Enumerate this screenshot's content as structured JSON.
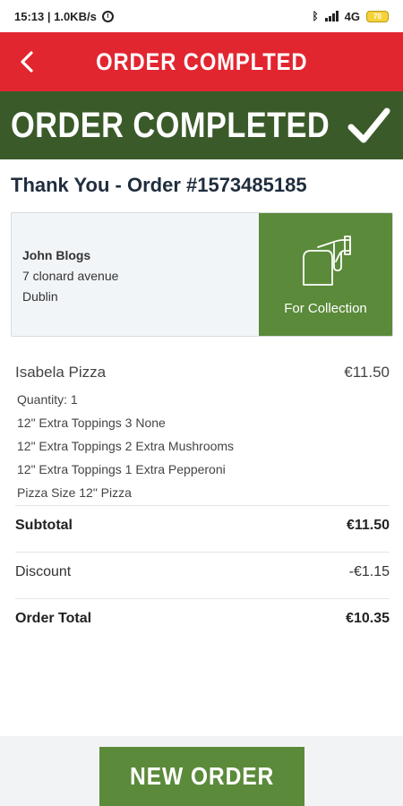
{
  "status_bar": {
    "time_speed": "15:13 | 1.0KB/s",
    "network": "4G",
    "battery": "70"
  },
  "app_bar": {
    "title": "ORDER COMPLTED",
    "back_icon": "chevron-left-icon"
  },
  "banner": {
    "text": "ORDER COMPLETED",
    "icon": "check-icon"
  },
  "thank_you": "Thank You - Order #1573485185",
  "customer": {
    "name": "John Blogs",
    "address_line1": "7 clonard avenue",
    "address_line2": "Dublin"
  },
  "collection": {
    "label": "For Collection",
    "icon": "collection-hand-icon"
  },
  "item": {
    "name": "Isabela Pizza",
    "price": "€11.50",
    "options": [
      "Quantity: 1",
      "12\" Extra Toppings 3 None",
      "12\" Extra Toppings 2 Extra Mushrooms",
      "12\" Extra Toppings 1 Extra Pepperoni",
      "Pizza Size 12\" Pizza"
    ]
  },
  "summary": {
    "subtotal_label": "Subtotal",
    "subtotal_value": "€11.50",
    "discount_label": "Discount",
    "discount_value": "-€1.15",
    "total_label": "Order Total",
    "total_value": "€10.35"
  },
  "new_order_button": "NEW ORDER",
  "colors": {
    "app_bar": "#e22630",
    "banner": "#3b5a2a",
    "accent_green": "#5b8a3a"
  }
}
